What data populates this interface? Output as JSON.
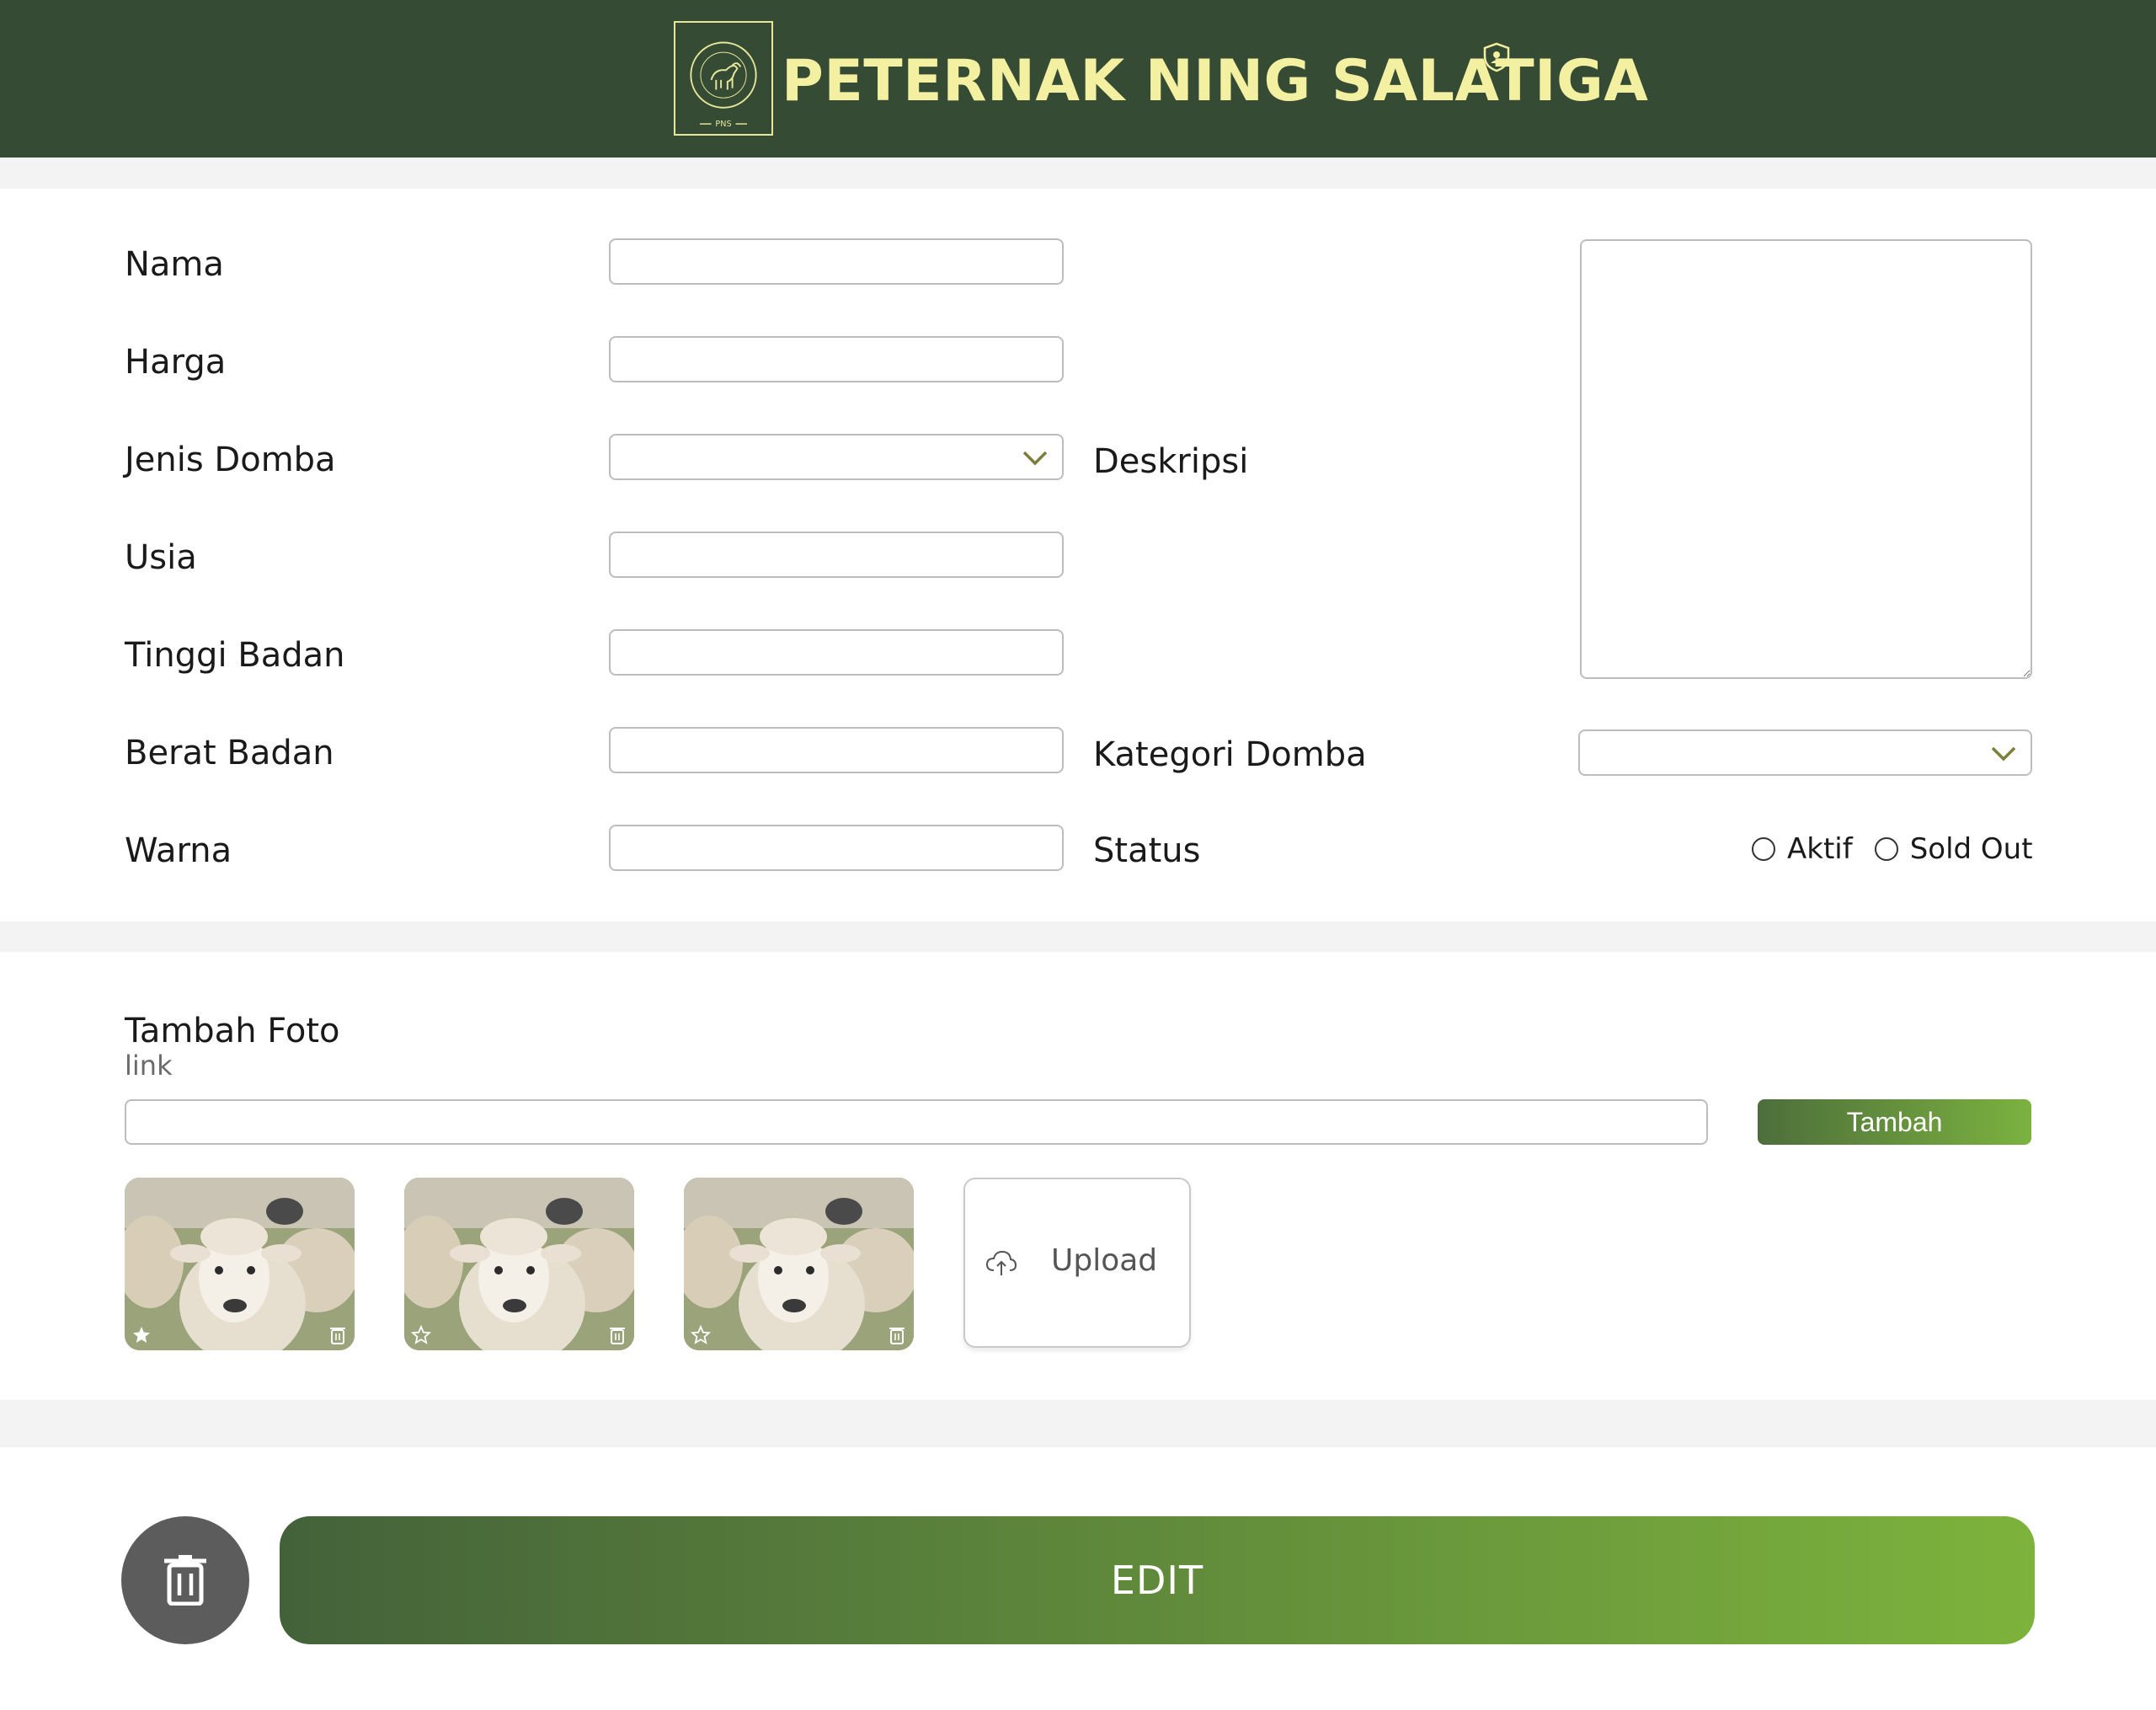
{
  "header": {
    "brand_name": "PETERNAK NING SALATIGA",
    "logo_text_top": "Peternak Ning Salatiga",
    "logo_text_bottom": "Peternak Ning Salatiga",
    "logo_abbr": "PNS",
    "admin_icon": "shield-user-icon"
  },
  "form": {
    "nama": {
      "label": "Nama",
      "value": ""
    },
    "harga": {
      "label": "Harga",
      "value": ""
    },
    "jenis_domba": {
      "label": "Jenis Domba",
      "value": ""
    },
    "usia": {
      "label": "Usia",
      "value": ""
    },
    "tinggi_badan": {
      "label": "Tinggi Badan",
      "value": ""
    },
    "berat_badan": {
      "label": "Berat Badan",
      "value": ""
    },
    "warna": {
      "label": "Warna",
      "value": ""
    },
    "deskripsi": {
      "label": "Deskripsi",
      "value": ""
    },
    "kategori_domba": {
      "label": "Kategori Domba",
      "value": ""
    },
    "status": {
      "label": "Status",
      "options": [
        "Aktif",
        "Sold Out"
      ],
      "selected": null
    }
  },
  "photos": {
    "title": "Tambah Foto",
    "link_label": "link",
    "link_value": "",
    "add_button": "Tambah",
    "items": [
      {
        "subject": "sheep",
        "primary": true
      },
      {
        "subject": "sheep",
        "primary": false
      },
      {
        "subject": "sheep",
        "primary": false
      }
    ],
    "upload_label": "Upload"
  },
  "actions": {
    "edit_label": "EDIT",
    "delete_icon": "trash-icon"
  },
  "colors": {
    "header_bg": "#354b34",
    "brand_text": "#f3f0a2",
    "accent_start": "#44623a",
    "accent_end": "#7db33c",
    "delete_bg": "#5c5c5c"
  }
}
